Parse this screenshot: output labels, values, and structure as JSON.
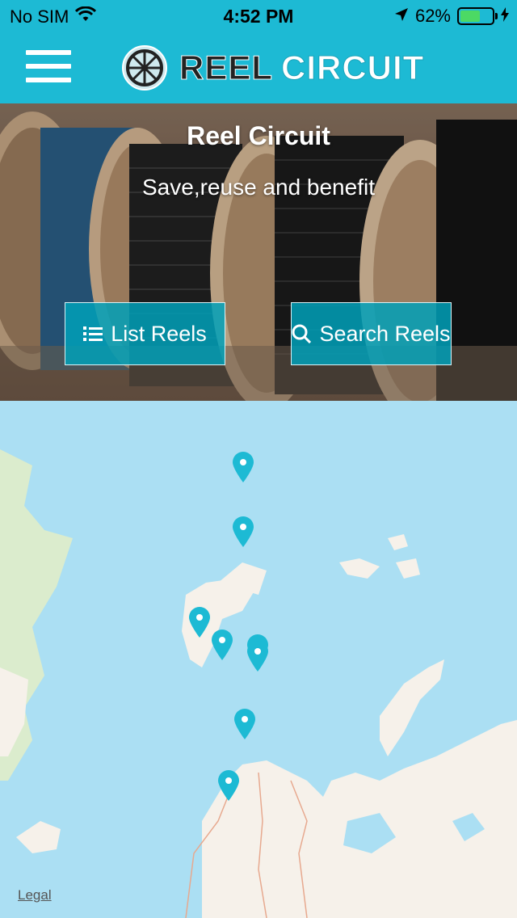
{
  "status_bar": {
    "carrier": "No SIM",
    "time": "4:52 PM",
    "battery_percent": "62%",
    "battery_level": 0.62,
    "icons": [
      "wifi-icon",
      "location-arrow-icon",
      "battery-icon",
      "charging-bolt-icon"
    ]
  },
  "navbar": {
    "menu_icon": "hamburger-menu-icon",
    "logo_word_1": "REEL",
    "logo_word_2": "CIRCUIT",
    "logo_icon": "reel-wheel-icon",
    "color": "#1dbad4"
  },
  "hero": {
    "title": "Reel Circuit",
    "subtitle": "Save,reuse and benefit",
    "list_button": {
      "label": "List Reels",
      "icon": "list-icon"
    },
    "search_button": {
      "label": "Search Reels",
      "icon": "search-icon"
    }
  },
  "map": {
    "legal_label": "Legal",
    "pin_icon": "map-pin-icon",
    "pin_color": "#1dbad4",
    "pin_count": 8
  }
}
